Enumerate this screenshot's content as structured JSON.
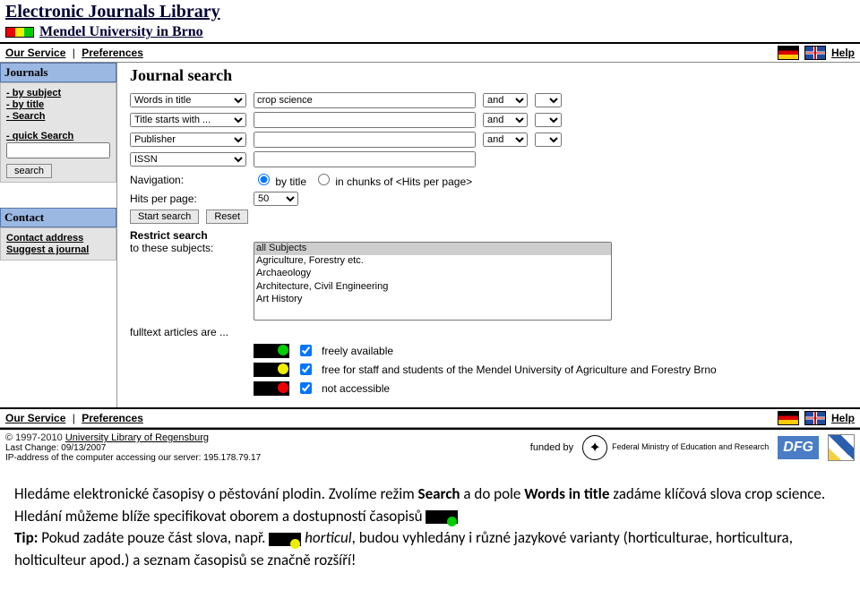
{
  "header": {
    "title": "Electronic Journals Library",
    "institution": "Mendel University in Brno"
  },
  "nav": {
    "service": "Our Service",
    "prefs": "Preferences",
    "help": "Help"
  },
  "sidebar": {
    "journals": {
      "title": "Journals",
      "by_subject": "- by subject",
      "by_title": "- by title",
      "search": "- Search",
      "quick": "- quick Search",
      "quick_placeholder": "",
      "search_btn": "search"
    },
    "contact": {
      "title": "Contact",
      "addr": "Contact address",
      "suggest": "Suggest a journal"
    }
  },
  "main": {
    "title": "Journal search",
    "fields": {
      "opt1": "Words in title",
      "opt2": "Title starts with ...",
      "opt3": "Publisher",
      "opt4": "ISSN"
    },
    "values": {
      "term1": "crop science",
      "term2": "",
      "term3": "",
      "term4": ""
    },
    "bool": {
      "and": "and"
    },
    "navigation": "Navigation:",
    "nav_opt1": "by title",
    "nav_opt2": "in chunks of <Hits per page>",
    "hits_label": "Hits per page:",
    "hits_value": "50",
    "start": "Start search",
    "reset": "Reset",
    "restrict": "Restrict search",
    "restrict_sub": "to these subjects:",
    "subjects": [
      "all Subjects",
      "Agriculture, Forestry etc.",
      "Archaeology",
      "Architecture, Civil Engineering",
      "Art History"
    ],
    "fulltext": "fulltext articles are ...",
    "avail": {
      "free": "freely available",
      "staff": "free for staff and students of the Mendel University of Agriculture and Forestry Brno",
      "not": "not accessible"
    }
  },
  "footer": {
    "copyright": "© 1997-2010 ",
    "lib": "University Library of Regensburg",
    "last_change": "Last Change: 09/13/2007",
    "ip": "IP-address of the computer accessing our server: 195.178.79.17",
    "funded": "funded by",
    "ministry": "Federal Ministry of Education and Research",
    "dfg": "DFG"
  },
  "below": {
    "l1a": "Hledáme elektronické časopisy o pěstování plodin. Zvolíme režim ",
    "l1b": "Search",
    "l1c": " a do pole ",
    "l1d": "Words in title",
    "l1e": " zadáme klíčová slova crop science. Hledání můžeme blíže specifikovat oborem a dostupností časopisů",
    "l2a": "Tip:",
    "l2b": " Pokud zadáte pouze část slova, např. ",
    "l2c": "horticul",
    "l2d": ", budou vyhledány i různé jazykové varianty (horticulturae, horticultura, holticulteur apod.) a seznam časopisů se značně rozšíří!"
  }
}
